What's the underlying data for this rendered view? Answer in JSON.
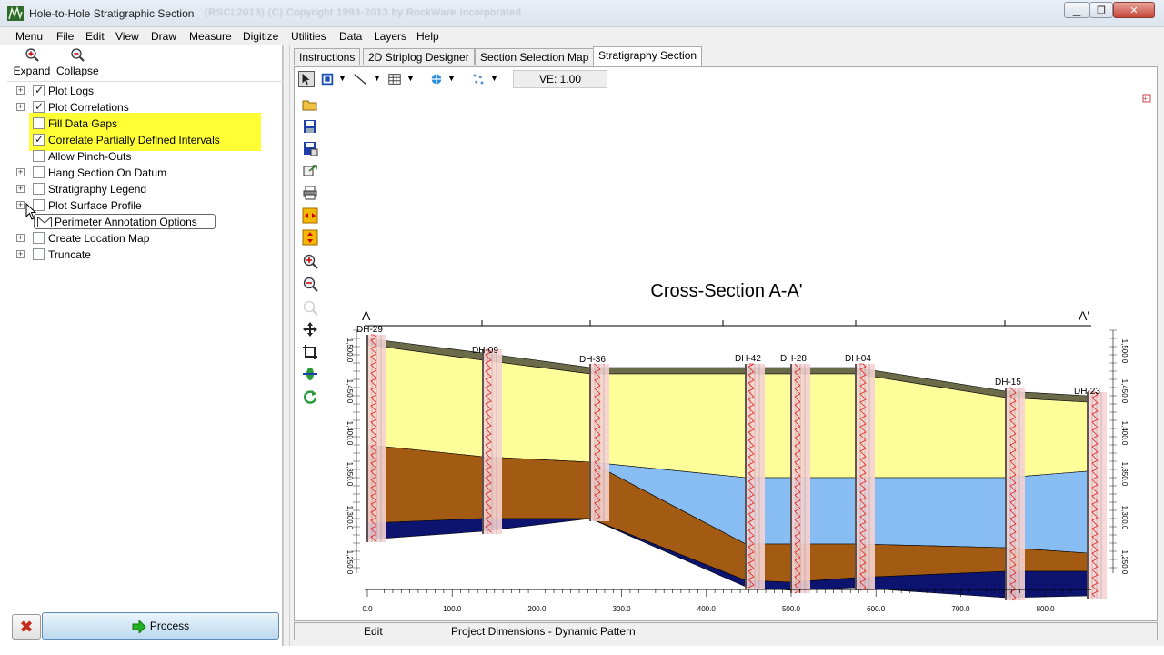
{
  "window": {
    "title": "Hole-to-Hole Stratigraphic Section",
    "blurred_subtitle": "(RSCL2013)  (C) Copyright 1993-2013 by RockWare Incorporated"
  },
  "menu": [
    "Menu",
    "File",
    "Edit",
    "View",
    "Draw",
    "Measure",
    "Digitize",
    "Utilities",
    "Data",
    "Layers",
    "Help"
  ],
  "left": {
    "toolbar": {
      "expand": "Expand",
      "collapse": "Collapse"
    },
    "tree": [
      {
        "label": "Plot Logs",
        "checked": true,
        "expandable": true
      },
      {
        "label": "Plot Correlations",
        "checked": true,
        "expandable": true
      },
      {
        "label": "Fill Data Gaps",
        "checked": false,
        "expandable": false
      },
      {
        "label": "Correlate Partially Defined Intervals",
        "checked": true,
        "expandable": false
      },
      {
        "label": "Allow Pinch-Outs",
        "checked": false,
        "expandable": false
      },
      {
        "label": "Hang Section On Datum",
        "checked": false,
        "expandable": true
      },
      {
        "label": "Stratigraphy Legend",
        "checked": false,
        "expandable": true
      },
      {
        "label": "Plot Surface Profile",
        "checked": false,
        "expandable": true
      },
      {
        "label": "Perimeter Annotation Options",
        "checked": false,
        "expandable": false
      },
      {
        "label": "Create Location Map",
        "checked": false,
        "expandable": true
      },
      {
        "label": "Truncate",
        "checked": false,
        "expandable": true
      }
    ],
    "process_label": "Process"
  },
  "tabs": [
    "Instructions",
    "2D Striplog Designer",
    "Section Selection Map",
    "Stratigraphy Section"
  ],
  "active_tab": 3,
  "ve_label": "VE: 1.00",
  "section": {
    "title": "Cross-Section A-A'",
    "start_label": "A",
    "end_label": "A'",
    "holes": [
      "DH-29",
      "DH-09",
      "DH-36",
      "DH-42",
      "DH-28",
      "DH-04",
      "DH-15",
      "DH-23"
    ],
    "x_ticks": [
      "0.0",
      "100.0",
      "200.0",
      "300.0",
      "400.0",
      "500.0",
      "600.0",
      "700.0",
      "800.0"
    ],
    "y_ticks": [
      "1,500.0",
      "1,450.0",
      "1,400.0",
      "1,350.0",
      "1,300.0",
      "1,250.0"
    ],
    "layer_colors": {
      "soil": "#6b6b4a",
      "yellow": "#fdfd9a",
      "brown": "#a35a12",
      "blue": "#88bdf4",
      "navy": "#0d1470",
      "log": "#f6d3d3"
    }
  },
  "status": {
    "mode": "Edit",
    "info": "Project Dimensions - Dynamic Pattern"
  }
}
